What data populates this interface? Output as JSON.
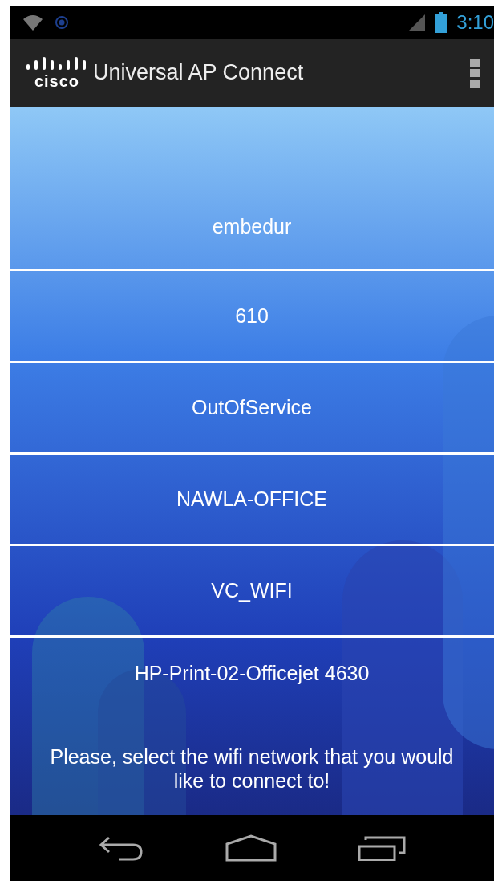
{
  "status_bar": {
    "time": "3:10"
  },
  "action_bar": {
    "logo": "cisco",
    "title": "Universal AP Connect"
  },
  "networks": [
    {
      "name": "embedur"
    },
    {
      "name": "610"
    },
    {
      "name": "OutOfService"
    },
    {
      "name": "NAWLA-OFFICE"
    },
    {
      "name": "VC_WIFI"
    },
    {
      "name": "HP-Print-02-Officejet 4630"
    }
  ],
  "message": "Please, select the wifi network that you would like to connect to!"
}
